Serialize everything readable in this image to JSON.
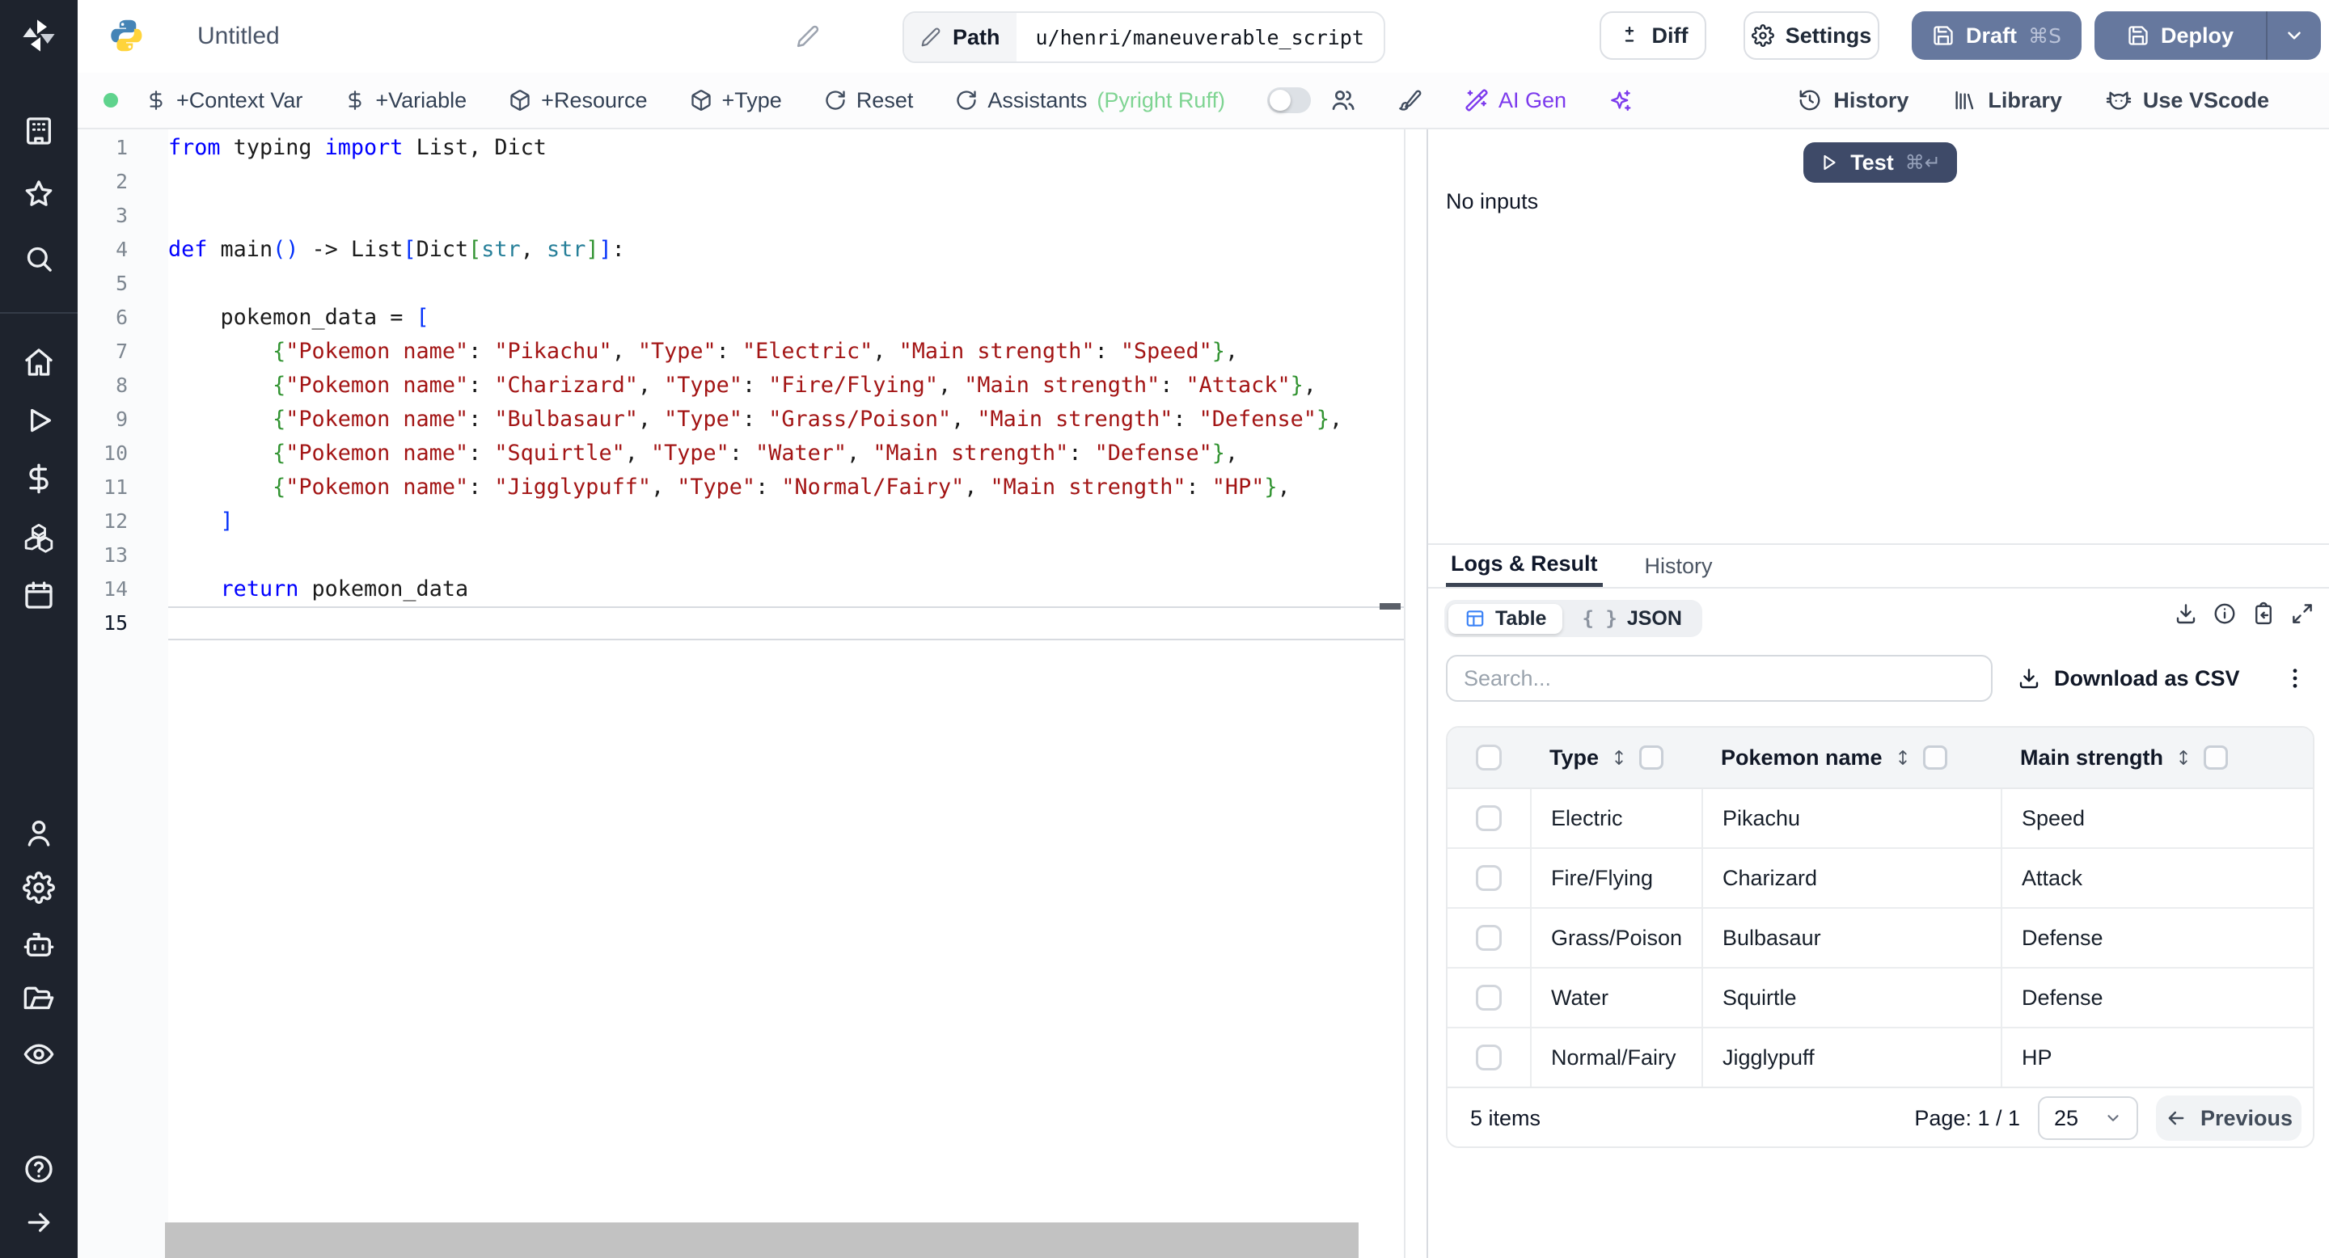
{
  "topbar": {
    "title": "Untitled",
    "path_label": "Path",
    "path_value": "u/henri/maneuverable_script",
    "diff_label": "Diff",
    "settings_label": "Settings",
    "draft_label": "Draft",
    "draft_shortcut": "⌘S",
    "deploy_label": "Deploy"
  },
  "toolbar": {
    "context_var": "+Context Var",
    "variable": "+Variable",
    "resource": "+Resource",
    "type": "+Type",
    "reset": "Reset",
    "assistants": "Assistants",
    "assistants_note": "(Pyright Ruff)",
    "ai_gen": "AI Gen",
    "history": "History",
    "library": "Library",
    "vscode": "Use VScode"
  },
  "sidebar": {
    "groups": [
      {
        "items": [
          {
            "name": "workspace",
            "icon": "building"
          },
          {
            "name": "favorites",
            "icon": "star"
          },
          {
            "name": "search",
            "icon": "search"
          }
        ]
      },
      {
        "items": [
          {
            "name": "home",
            "icon": "home"
          },
          {
            "name": "runs",
            "icon": "play"
          },
          {
            "name": "variables",
            "icon": "dollar"
          },
          {
            "name": "resources",
            "icon": "boxes"
          },
          {
            "name": "schedules",
            "icon": "calendar"
          }
        ]
      },
      {
        "items": [
          {
            "name": "users",
            "icon": "user"
          },
          {
            "name": "settings",
            "icon": "gear"
          },
          {
            "name": "workers",
            "icon": "robot"
          },
          {
            "name": "folders",
            "icon": "folder"
          },
          {
            "name": "audit-logs",
            "icon": "eye"
          }
        ]
      },
      {
        "items": [
          {
            "name": "help",
            "icon": "help"
          },
          {
            "name": "expand-sidebar",
            "icon": "arrow-right"
          }
        ]
      }
    ]
  },
  "editor": {
    "active_line": 15,
    "lines": [
      [
        [
          "kw",
          "from"
        ],
        [
          "pl",
          " typing "
        ],
        [
          "kw",
          "import"
        ],
        [
          "pl",
          " List, Dict"
        ]
      ],
      [],
      [],
      [
        [
          "kw",
          "def"
        ],
        [
          "pl",
          " main"
        ],
        [
          "b1",
          "()"
        ],
        [
          "pl",
          " -> List"
        ],
        [
          "b1",
          "["
        ],
        [
          "pl",
          "Dict"
        ],
        [
          "b2",
          "["
        ],
        [
          "ty",
          "str"
        ],
        [
          "pl",
          ", "
        ],
        [
          "ty",
          "str"
        ],
        [
          "b2",
          "]"
        ],
        [
          "b1",
          "]"
        ],
        [
          "pl",
          ":"
        ]
      ],
      [],
      [
        [
          "pl",
          "    pokemon_data = "
        ],
        [
          "b1",
          "["
        ]
      ],
      [
        [
          "pl",
          "        "
        ],
        [
          "b2",
          "{"
        ],
        [
          "str",
          "\"Pokemon name\""
        ],
        [
          "pl",
          ": "
        ],
        [
          "str",
          "\"Pikachu\""
        ],
        [
          "pl",
          ", "
        ],
        [
          "str",
          "\"Type\""
        ],
        [
          "pl",
          ": "
        ],
        [
          "str",
          "\"Electric\""
        ],
        [
          "pl",
          ", "
        ],
        [
          "str",
          "\"Main strength\""
        ],
        [
          "pl",
          ": "
        ],
        [
          "str",
          "\"Speed\""
        ],
        [
          "b2",
          "}"
        ],
        [
          "pl",
          ","
        ]
      ],
      [
        [
          "pl",
          "        "
        ],
        [
          "b2",
          "{"
        ],
        [
          "str",
          "\"Pokemon name\""
        ],
        [
          "pl",
          ": "
        ],
        [
          "str",
          "\"Charizard\""
        ],
        [
          "pl",
          ", "
        ],
        [
          "str",
          "\"Type\""
        ],
        [
          "pl",
          ": "
        ],
        [
          "str",
          "\"Fire/Flying\""
        ],
        [
          "pl",
          ", "
        ],
        [
          "str",
          "\"Main strength\""
        ],
        [
          "pl",
          ": "
        ],
        [
          "str",
          "\"Attack\""
        ],
        [
          "b2",
          "}"
        ],
        [
          "pl",
          ","
        ]
      ],
      [
        [
          "pl",
          "        "
        ],
        [
          "b2",
          "{"
        ],
        [
          "str",
          "\"Pokemon name\""
        ],
        [
          "pl",
          ": "
        ],
        [
          "str",
          "\"Bulbasaur\""
        ],
        [
          "pl",
          ", "
        ],
        [
          "str",
          "\"Type\""
        ],
        [
          "pl",
          ": "
        ],
        [
          "str",
          "\"Grass/Poison\""
        ],
        [
          "pl",
          ", "
        ],
        [
          "str",
          "\"Main strength\""
        ],
        [
          "pl",
          ": "
        ],
        [
          "str",
          "\"Defense\""
        ],
        [
          "b2",
          "}"
        ],
        [
          "pl",
          ","
        ]
      ],
      [
        [
          "pl",
          "        "
        ],
        [
          "b2",
          "{"
        ],
        [
          "str",
          "\"Pokemon name\""
        ],
        [
          "pl",
          ": "
        ],
        [
          "str",
          "\"Squirtle\""
        ],
        [
          "pl",
          ", "
        ],
        [
          "str",
          "\"Type\""
        ],
        [
          "pl",
          ": "
        ],
        [
          "str",
          "\"Water\""
        ],
        [
          "pl",
          ", "
        ],
        [
          "str",
          "\"Main strength\""
        ],
        [
          "pl",
          ": "
        ],
        [
          "str",
          "\"Defense\""
        ],
        [
          "b2",
          "}"
        ],
        [
          "pl",
          ","
        ]
      ],
      [
        [
          "pl",
          "        "
        ],
        [
          "b2",
          "{"
        ],
        [
          "str",
          "\"Pokemon name\""
        ],
        [
          "pl",
          ": "
        ],
        [
          "str",
          "\"Jigglypuff\""
        ],
        [
          "pl",
          ", "
        ],
        [
          "str",
          "\"Type\""
        ],
        [
          "pl",
          ": "
        ],
        [
          "str",
          "\"Normal/Fairy\""
        ],
        [
          "pl",
          ", "
        ],
        [
          "str",
          "\"Main strength\""
        ],
        [
          "pl",
          ": "
        ],
        [
          "str",
          "\"HP\""
        ],
        [
          "b2",
          "}"
        ],
        [
          "pl",
          ","
        ]
      ],
      [
        [
          "pl",
          "    "
        ],
        [
          "b1",
          "]"
        ]
      ],
      [],
      [
        [
          "pl",
          "    "
        ],
        [
          "kw",
          "return"
        ],
        [
          "pl",
          " pokemon_data"
        ]
      ],
      []
    ]
  },
  "run_panel": {
    "test_label": "Test",
    "test_shortcut": "⌘↵",
    "no_inputs": "No inputs"
  },
  "result_panel": {
    "tabs": [
      "Logs & Result",
      "History"
    ],
    "view_toggle": {
      "table": "Table",
      "json": "JSON",
      "braces": "{ }"
    },
    "search_placeholder": "Search...",
    "download_csv_label": "Download as CSV",
    "table": {
      "columns": [
        "Type",
        "Pokemon name",
        "Main strength"
      ],
      "rows": [
        [
          "Electric",
          "Pikachu",
          "Speed"
        ],
        [
          "Fire/Flying",
          "Charizard",
          "Attack"
        ],
        [
          "Grass/Poison",
          "Bulbasaur",
          "Defense"
        ],
        [
          "Water",
          "Squirtle",
          "Defense"
        ],
        [
          "Normal/Fairy",
          "Jigglypuff",
          "HP"
        ]
      ]
    },
    "footer": {
      "items_text": "5 items",
      "page_text": "Page: 1 / 1",
      "page_size": "25",
      "prev_label": "Previous"
    }
  },
  "colors": {
    "primary_button": "#66789e",
    "test_button": "#3e4a68",
    "ai_accent": "#7c3aed",
    "ready_dot": "#5fd38d",
    "table_icon": "#3b82f6",
    "lint_ok": "#7ed492",
    "sidebar_bg": "#1e232d"
  }
}
